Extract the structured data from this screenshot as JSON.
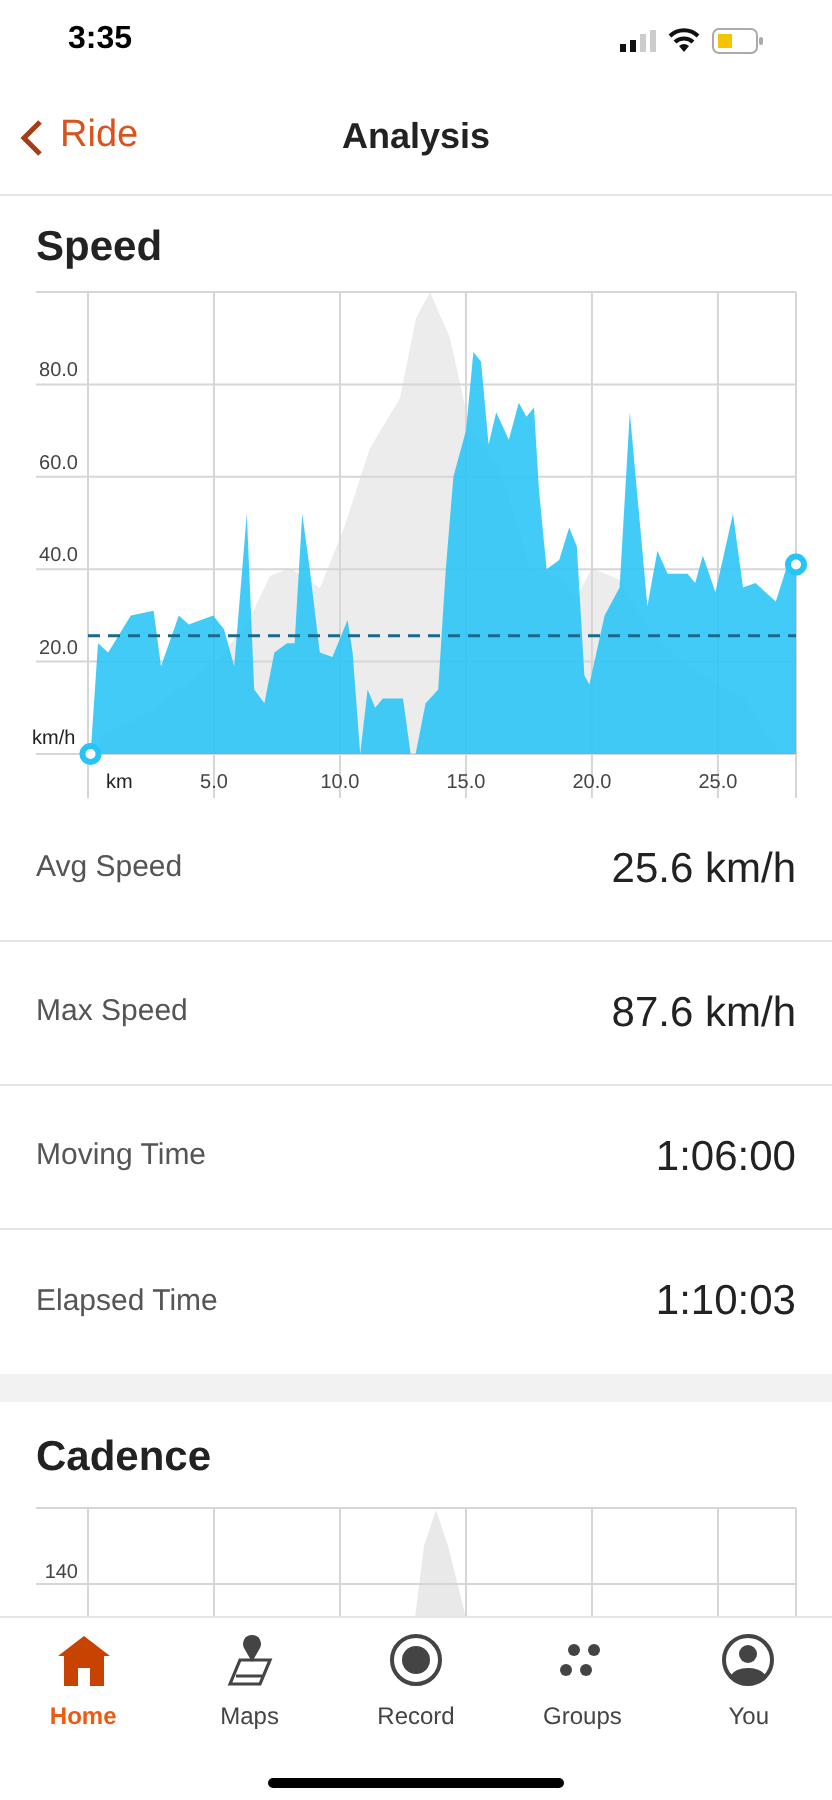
{
  "status_bar": {
    "time": "3:35"
  },
  "nav": {
    "back_label": "Ride",
    "title": "Analysis"
  },
  "speed": {
    "chart_data": {
      "type": "area",
      "title": "Speed",
      "grid": true,
      "xlabel": "km",
      "ylabel": "km/h",
      "xlim": [
        0,
        28.1
      ],
      "ylim": [
        0,
        100
      ],
      "xticks": [
        {
          "value": 5,
          "label": "5.0"
        },
        {
          "value": 10,
          "label": "10.0"
        },
        {
          "value": 15,
          "label": "15.0"
        },
        {
          "value": 20,
          "label": "20.0"
        },
        {
          "value": 25,
          "label": "25.0"
        }
      ],
      "yticks": [
        {
          "value": 20,
          "label": "20.0"
        },
        {
          "value": 40,
          "label": "40.0"
        },
        {
          "value": 60,
          "label": "60.0"
        },
        {
          "value": 80,
          "label": "80.0"
        }
      ],
      "x": [
        0.1,
        0.4,
        0.8,
        1.7,
        2.6,
        2.9,
        3.6,
        4.0,
        4.97,
        5.4,
        5.8,
        6.3,
        6.6,
        7.0,
        7.4,
        7.9,
        8.2,
        8.5,
        8.8,
        9.2,
        9.7,
        10.3,
        10.5,
        10.8,
        11.1,
        11.4,
        11.7,
        12.2,
        12.5,
        12.8,
        13.0,
        13.4,
        13.9,
        14.2,
        14.5,
        15.0,
        15.3,
        15.6,
        15.9,
        16.2,
        16.7,
        17.1,
        17.4,
        17.7,
        17.9,
        18.2,
        18.7,
        19.1,
        19.4,
        19.7,
        19.9,
        20.5,
        21.1,
        21.5,
        22.2,
        22.6,
        23.0,
        23.8,
        24.1,
        24.4,
        24.9,
        25.6,
        26.0,
        26.5,
        27.3,
        27.7,
        28.1
      ],
      "series": [
        {
          "color": "#29c4f6",
          "values": [
            0,
            24,
            22,
            30,
            31,
            19,
            30,
            28,
            30,
            27,
            19,
            52,
            14,
            11,
            22,
            24,
            24,
            52,
            40,
            22,
            21,
            29,
            22,
            0,
            14,
            10,
            12,
            12,
            12,
            0,
            0,
            11,
            14,
            40,
            60,
            70,
            87,
            85,
            67,
            74,
            68,
            76,
            73,
            75,
            57,
            40,
            42,
            49,
            45,
            17,
            15,
            30,
            36,
            74,
            32,
            44,
            39,
            39,
            37,
            43,
            35,
            52,
            36,
            37,
            33,
            40,
            41
          ]
        }
      ],
      "ref_lines": [
        {
          "axis": "y",
          "value": 25.6
        }
      ]
    }
  },
  "stats": [
    {
      "label": "Avg Speed",
      "value": "25.6 km/h"
    },
    {
      "label": "Max Speed",
      "value": "87.6 km/h"
    },
    {
      "label": "Moving Time",
      "value": "1:06:00"
    },
    {
      "label": "Elapsed Time",
      "value": "1:10:03"
    }
  ],
  "cadence": {
    "title": "Cadence",
    "tick_label": "140"
  },
  "tab_bar": [
    {
      "kind": "home",
      "label": "Home",
      "selected": true
    },
    {
      "kind": "maps",
      "label": "Maps",
      "selected": false
    },
    {
      "kind": "record",
      "label": "Record",
      "selected": false
    },
    {
      "kind": "groups",
      "label": "Groups",
      "selected": false
    },
    {
      "kind": "you",
      "label": "You",
      "selected": false
    }
  ]
}
